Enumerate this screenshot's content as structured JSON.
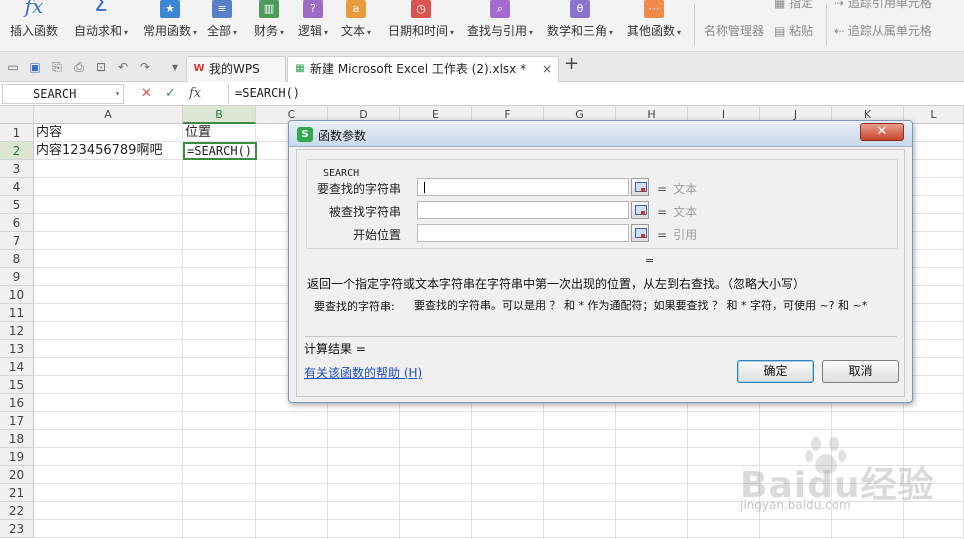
{
  "ribbon": {
    "items": [
      {
        "label": "插入函数",
        "has_arrow": false
      },
      {
        "label": "自动求和",
        "has_arrow": true
      },
      {
        "label": "常用函数",
        "has_arrow": true
      },
      {
        "label": "全部",
        "has_arrow": true
      },
      {
        "label": "财务",
        "has_arrow": true
      },
      {
        "label": "逻辑",
        "has_arrow": true
      },
      {
        "label": "文本",
        "has_arrow": true
      },
      {
        "label": "日期和时间",
        "has_arrow": true
      },
      {
        "label": "查找与引用",
        "has_arrow": true
      },
      {
        "label": "数学和三角",
        "has_arrow": true
      },
      {
        "label": "其他函数",
        "has_arrow": true
      }
    ],
    "name_manager": "名称管理器",
    "paste": "粘贴",
    "specify": "指定",
    "trace_precedents": "追踪引用单元格",
    "trace_dependents": "追踪从属单元格"
  },
  "tabs": [
    {
      "label": "我的WPS"
    },
    {
      "label": "新建 Microsoft Excel 工作表 (2).xlsx *"
    }
  ],
  "formula_bar": {
    "name_box": "SEARCH",
    "fx": "fx",
    "formula": "=SEARCH()"
  },
  "sheet": {
    "columns": [
      "A",
      "B",
      "C",
      "D",
      "E",
      "F",
      "G",
      "H",
      "I",
      "J",
      "K",
      "L"
    ],
    "rows": [
      "1",
      "2",
      "3",
      "4",
      "5",
      "6",
      "7",
      "8",
      "9",
      "10",
      "11",
      "12",
      "13",
      "14",
      "15",
      "16",
      "17",
      "18",
      "19",
      "20",
      "21",
      "22",
      "23"
    ],
    "cells": {
      "A1": "内容",
      "B1": "位置",
      "A2": "内容123456789啊吧",
      "B2": "=SEARCH()"
    },
    "selected_column": "B",
    "selected_row": "2"
  },
  "dialog": {
    "title": "函数参数",
    "function_name": "SEARCH",
    "args": [
      {
        "label": "要查找的字符串",
        "value": "",
        "hint": "文本"
      },
      {
        "label": "被查找字符串",
        "value": "",
        "hint": "文本"
      },
      {
        "label": "开始位置",
        "value": "",
        "hint": "引用"
      }
    ],
    "middle_equals": "=",
    "description": "返回一个指定字符或文本字符串在字符串中第一次出现的位置，从左到右查找。（忽略大小写）",
    "arg_desc_name": "要查找的字符串:",
    "arg_desc_text": "要查找的字符串。可以是用 ？ 和 * 作为通配符；如果要查找 ？ 和 * 字符，可使用 ~? 和 ~*",
    "result_label": "计算结果 =",
    "help_link": "有关该函数的帮助 (H)",
    "ok_label": "确定",
    "cancel_label": "取消"
  },
  "watermark": {
    "brand": "Baidu经验",
    "url": "jingyan.baidu.com"
  }
}
